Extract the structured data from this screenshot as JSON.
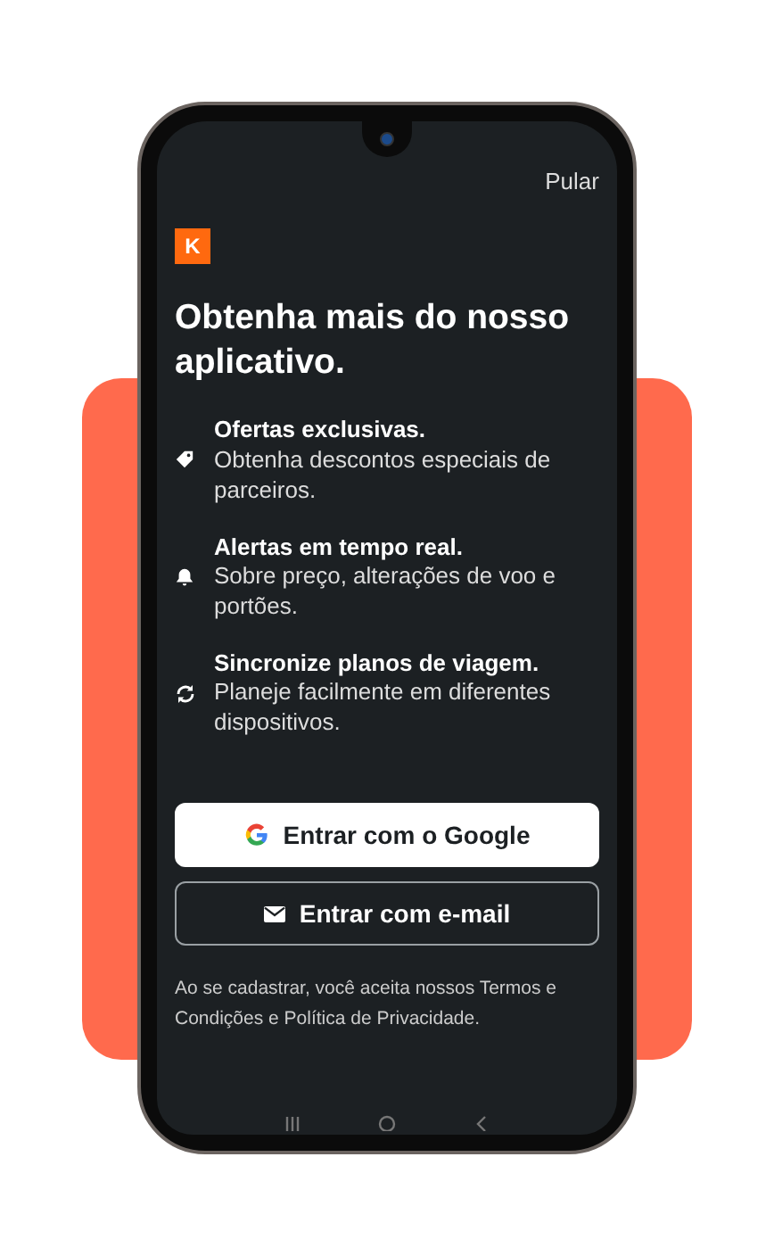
{
  "skip_link": "Pular",
  "logo": "K",
  "title": "Obtenha mais do nosso aplicativo.",
  "features": [
    {
      "kind": "tag",
      "title": "Ofertas exclusivas.",
      "text": "Obtenha descontos especiais de parceiros."
    },
    {
      "kind": "bell",
      "title": "Alertas em tempo real.",
      "text": "Sobre preço, alterações de voo e portões."
    },
    {
      "kind": "sync",
      "title": "Sincronize planos de viagem.",
      "text": "Planeje facilmente em diferentes dispositivos."
    }
  ],
  "buttons": [
    {
      "kind": "google",
      "label": "Entrar com o Google"
    },
    {
      "kind": "email",
      "label": "Entrar com e-mail"
    }
  ],
  "terms": "Ao se cadastrar, você aceita nossos Termos e Condições e Política de Privacidade."
}
